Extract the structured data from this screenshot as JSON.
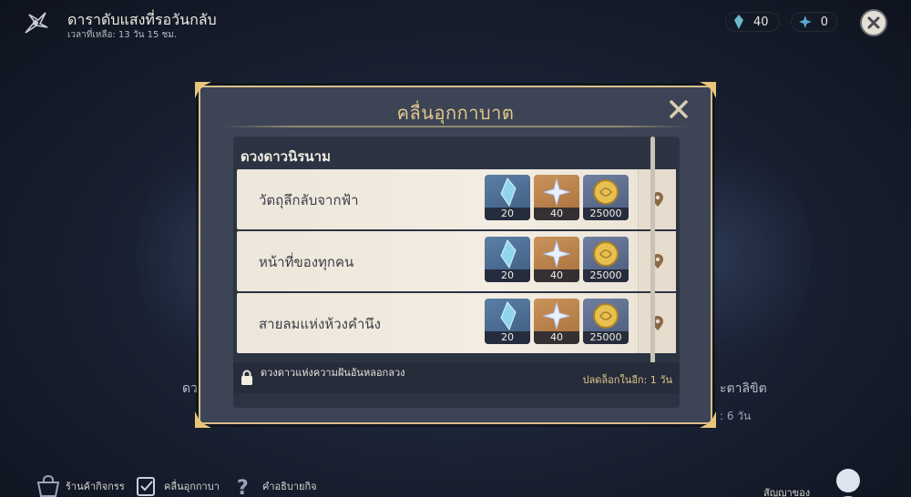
{
  "header": {
    "title": "ดาราดับแสงที่รอวันกลับ",
    "time_left": "เวลาที่เหลือ: 13 วัน 15 ชม."
  },
  "currencies": [
    {
      "icon": "crystal-feather-icon",
      "value": "40"
    },
    {
      "icon": "star-emblem-icon",
      "value": "0"
    }
  ],
  "background": {
    "left_text": "ดว",
    "right_text": "ะตาลิขิต",
    "right_sub": ": 6 วัน"
  },
  "modal": {
    "title": "คลื่นอุกกาบาต",
    "section_title": "ดวงดาวนิรนาม",
    "quests": [
      {
        "name": "วัตถุลึกลับจากฟ้า",
        "rewards": [
          {
            "icon": "crystal-shard-icon",
            "count": "20"
          },
          {
            "icon": "primogem-star-icon",
            "count": "40"
          },
          {
            "icon": "mora-coin-icon",
            "count": "25000"
          }
        ]
      },
      {
        "name": "หน้าที่ของทุกคน",
        "rewards": [
          {
            "icon": "crystal-shard-icon",
            "count": "20"
          },
          {
            "icon": "primogem-star-icon",
            "count": "40"
          },
          {
            "icon": "mora-coin-icon",
            "count": "25000"
          }
        ]
      },
      {
        "name": "สายลมแห่งห้วงคำนึง",
        "rewards": [
          {
            "icon": "crystal-shard-icon",
            "count": "20"
          },
          {
            "icon": "primogem-star-icon",
            "count": "40"
          },
          {
            "icon": "mora-coin-icon",
            "count": "25000"
          }
        ]
      }
    ],
    "locked": {
      "name": "ดวงดาวแห่งความฝันอันหลอกลวง",
      "unlock_text": "ปลดล็อกในอีก: 1 วัน"
    }
  },
  "bottom_nav": {
    "item_1": "ร้านค้ากิจกรร",
    "item_2": "คลื่นอุกกาบา",
    "item_3": "คำอธิบายกิจ",
    "item_right": "สัญญาของ"
  },
  "colors": {
    "accent_gold": "#e3c78a",
    "modal_bg": "#3c4456",
    "row_bg": "#f3ede2"
  }
}
